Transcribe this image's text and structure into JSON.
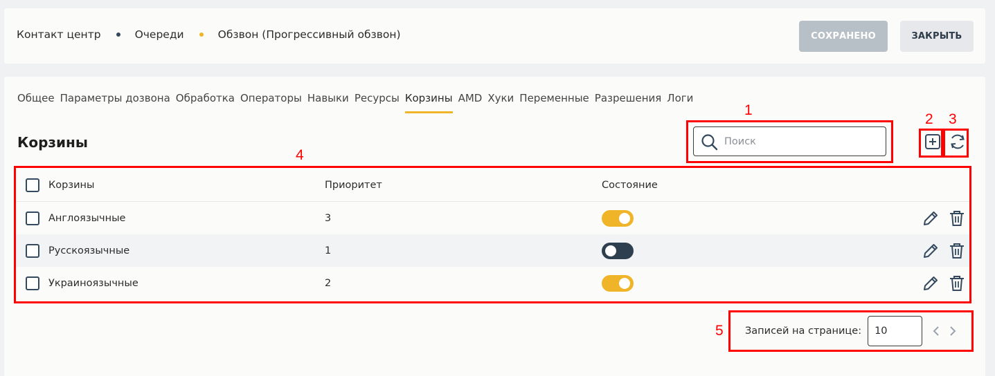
{
  "breadcrumbs": [
    {
      "label": "Контакт центр"
    },
    {
      "label": "Очереди"
    },
    {
      "label": "Обзвон (Прогрессивный обзвон)"
    }
  ],
  "breadcrumb_dot_colors": [
    "#34495e",
    "#f0b429"
  ],
  "header": {
    "saved_label": "СОХРАНЕНО",
    "close_label": "ЗАКРЫТЬ"
  },
  "tabs": [
    {
      "label": "Общее"
    },
    {
      "label": "Параметры дозвона"
    },
    {
      "label": "Обработка"
    },
    {
      "label": "Операторы"
    },
    {
      "label": "Навыки"
    },
    {
      "label": "Ресурсы"
    },
    {
      "label": "Корзины",
      "active": true
    },
    {
      "label": "AMD"
    },
    {
      "label": "Хуки"
    },
    {
      "label": "Переменные"
    },
    {
      "label": "Разрешения"
    },
    {
      "label": "Логи"
    }
  ],
  "section": {
    "title": "Корзины",
    "search_placeholder": "Поиск"
  },
  "table": {
    "columns": {
      "name": "Корзины",
      "priority": "Приоритет",
      "state": "Состояние"
    },
    "rows": [
      {
        "name": "Англоязычные",
        "priority": "3",
        "enabled": true
      },
      {
        "name": "Русскоязычные",
        "priority": "1",
        "enabled": false
      },
      {
        "name": "Украиноязычные",
        "priority": "2",
        "enabled": true
      }
    ]
  },
  "pagination": {
    "label": "Записей на странице:",
    "per_page": "10"
  },
  "annotations": [
    "1",
    "2",
    "3",
    "4",
    "5"
  ],
  "colors": {
    "accent": "#f0b429",
    "dark": "#34495e",
    "annotation": "#ff0000",
    "toggle_on": "#f0b429",
    "toggle_off": "#2e3f50"
  },
  "icons": [
    "search-icon",
    "add-icon",
    "refresh-icon",
    "edit-icon",
    "delete-icon",
    "chevron-left-icon",
    "chevron-right-icon"
  ]
}
